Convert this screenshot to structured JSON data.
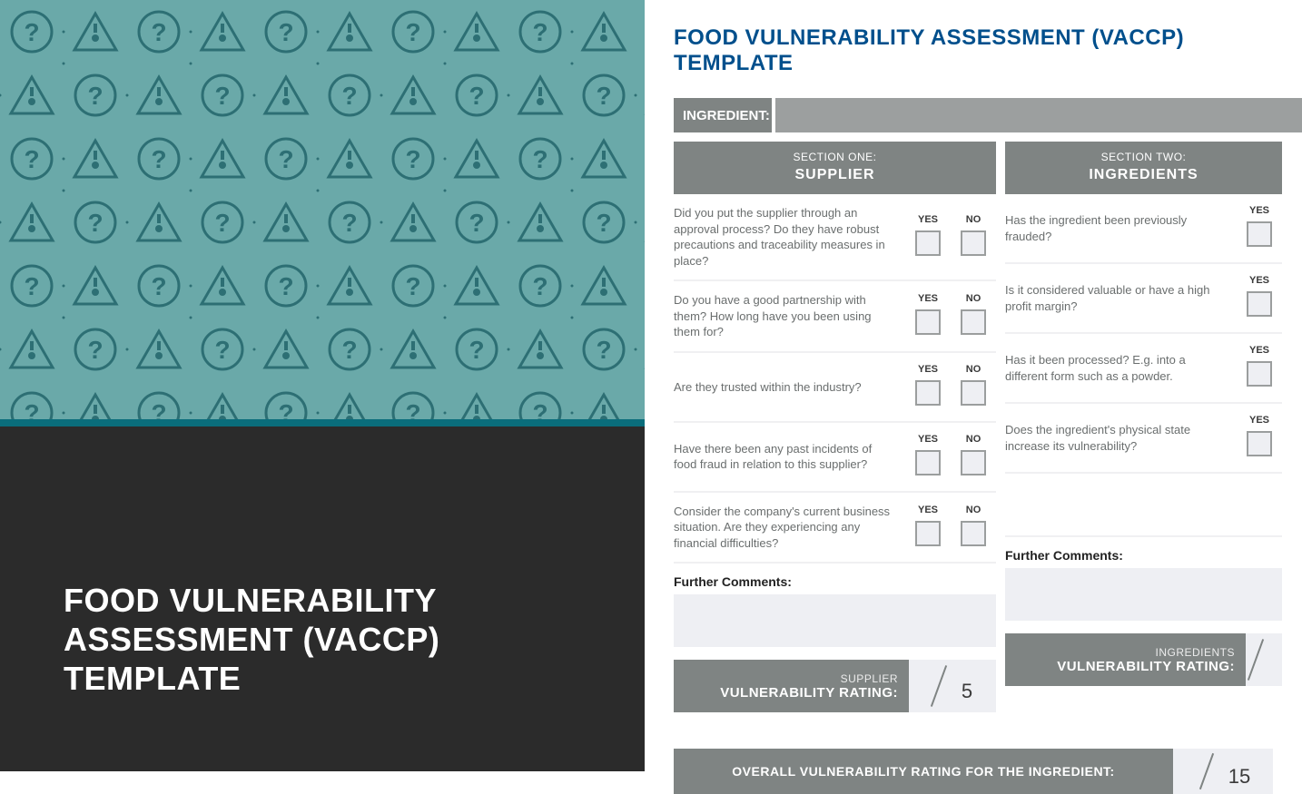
{
  "cover": {
    "title": "FOOD VULNERABILITY ASSESSMENT (VACCP) TEMPLATE"
  },
  "page": {
    "title": "FOOD VULNERABILITY ASSESSMENT (VACCP) TEMPLATE",
    "ingredient_label": "INGREDIENT:",
    "yes": "YES",
    "no": "NO",
    "section1": {
      "small": "SECTION ONE:",
      "big": "SUPPLIER",
      "questions": [
        "Did you put the supplier through an approval process? Do they have robust precautions and traceability measures in place?",
        "Do you have a good partnership with them? How long have you been using them for?",
        "Are they trusted within the industry?",
        "Have there been any past incidents of food fraud in relation to this supplier?",
        "Consider the company's current business situation. Are they experiencing any financial difficulties?"
      ],
      "further": "Further Comments:",
      "rating_small": "SUPPLIER",
      "rating_big": "VULNERABILITY RATING:",
      "rating_max": "5"
    },
    "section2": {
      "small": "SECTION TWO:",
      "big": "INGREDIENTS",
      "questions": [
        "Has the ingredient been previously frauded?",
        "Is it considered valuable or have a high profit margin?",
        "Has it been processed? E.g. into a different form such as a powder.",
        "Does the ingredient's physical state increase its vulnerability?"
      ],
      "further": "Further Comments:",
      "rating_small": "INGREDIENTS",
      "rating_big": "VULNERABILITY RATING:"
    },
    "overall": {
      "label": "OVERALL VULNERABILITY RATING FOR THE INGREDIENT:",
      "max": "15"
    }
  }
}
